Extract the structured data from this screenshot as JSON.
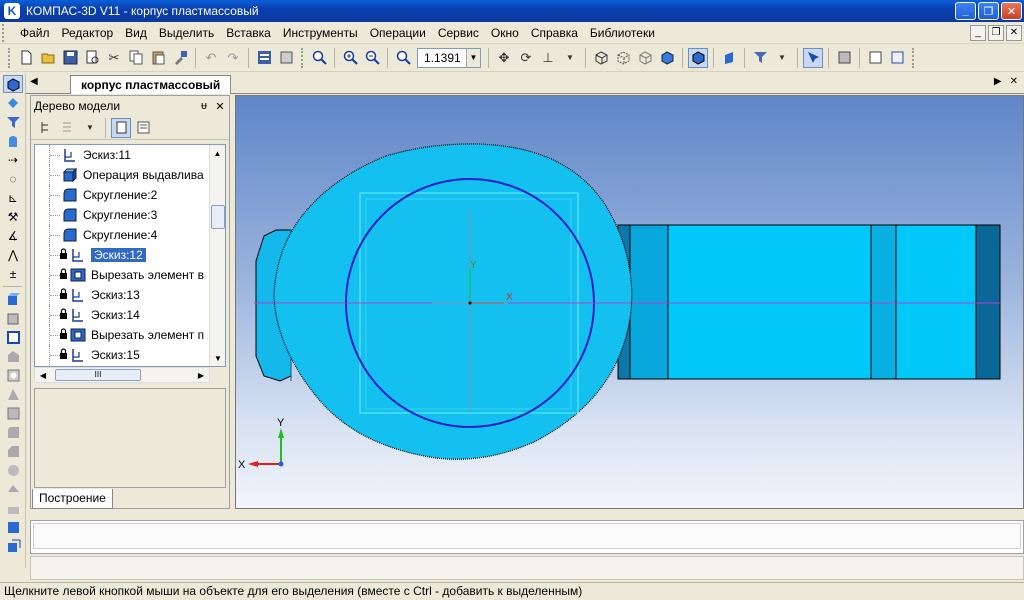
{
  "window": {
    "title": "КОМПАС-3D V11 - корпус пластмассовый",
    "app_icon_letter": "K",
    "min_label": "_",
    "max_label": "❐",
    "close_label": "✕"
  },
  "menu": {
    "items": [
      "Файл",
      "Редактор",
      "Вид",
      "Выделить",
      "Вставка",
      "Инструменты",
      "Операции",
      "Сервис",
      "Окно",
      "Справка",
      "Библиотеки"
    ]
  },
  "toolbar": {
    "zoom_value": "1.1391"
  },
  "document_tab": {
    "label": "корпус пластмассовый"
  },
  "tree_panel": {
    "title": "Дерево модели",
    "pin_label": "ᵾ",
    "close_label": "✕",
    "items": [
      {
        "label": "Эскиз:11",
        "icon": "sketch-icon",
        "locked": false,
        "selected": false
      },
      {
        "label": "Операция выдавлива",
        "icon": "extrude-icon",
        "locked": false,
        "selected": false
      },
      {
        "label": "Скругление:2",
        "icon": "fillet-icon",
        "locked": false,
        "selected": false
      },
      {
        "label": "Скругление:3",
        "icon": "fillet-icon",
        "locked": false,
        "selected": false
      },
      {
        "label": "Скругление:4",
        "icon": "fillet-icon",
        "locked": false,
        "selected": false
      },
      {
        "label": "Эскиз:12",
        "icon": "sketch-icon",
        "locked": true,
        "selected": true
      },
      {
        "label": "Вырезать элемент в",
        "icon": "cut-icon",
        "locked": true,
        "selected": false
      },
      {
        "label": "Эскиз:13",
        "icon": "sketch-icon",
        "locked": true,
        "selected": false
      },
      {
        "label": "Эскиз:14",
        "icon": "sketch-icon",
        "locked": true,
        "selected": false
      },
      {
        "label": "Вырезать элемент п",
        "icon": "cut-icon",
        "locked": true,
        "selected": false
      },
      {
        "label": "Эскиз:15",
        "icon": "sketch-icon",
        "locked": true,
        "selected": false
      }
    ],
    "hscroll_thumb_label": "III",
    "bottom_tab": "Построение"
  },
  "viewport": {
    "axis_x": "X",
    "axis_y": "Y",
    "origin_x": "X",
    "origin_y": "Y"
  },
  "status": {
    "text": "Щелкните левой кнопкой мыши на объекте для его выделения (вместе с Ctrl - добавить к выделенным)"
  }
}
